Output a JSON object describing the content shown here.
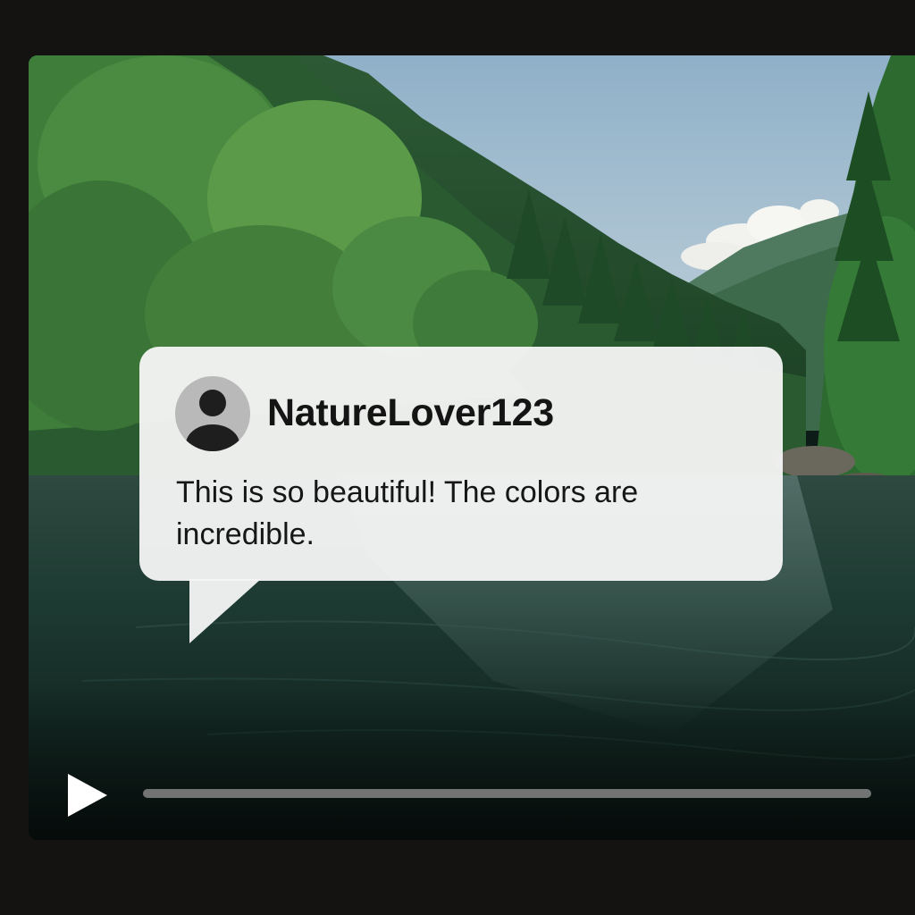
{
  "comment": {
    "username": "NatureLover123",
    "text": "This is so beautiful! The colors are incredible.",
    "avatar_icon": "user-avatar-icon"
  },
  "player": {
    "play_icon": "play-icon",
    "progress": 0,
    "state": "paused"
  },
  "colors": {
    "frame_background": "#151311",
    "bubble_background": "#f5f5f5",
    "progress_track": "#969696"
  }
}
